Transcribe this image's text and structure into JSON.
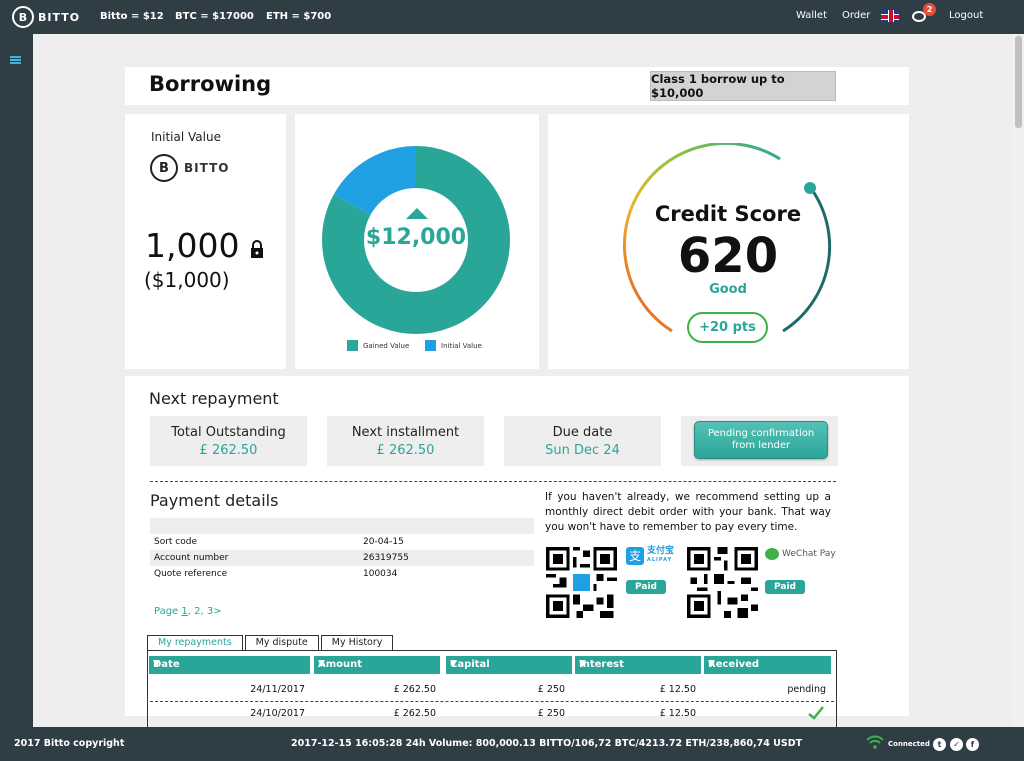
{
  "header": {
    "brand": "BITTO",
    "brand_glyph": "B",
    "tickers": [
      "Bitto = $12",
      "BTC = $17000",
      "ETH = $700"
    ],
    "nav": {
      "wallet": "Wallet",
      "order": "Order",
      "logout": "Logout"
    },
    "notification_count": "2"
  },
  "page": {
    "title": "Borrowing",
    "class_button": "Class 1 borrow up to $10,000"
  },
  "initial_value": {
    "label": "Initial Value",
    "brand": "BITTO",
    "amount": "1,000",
    "usd": "($1,000)"
  },
  "donut": {
    "value": "$12,000",
    "legend": [
      {
        "label": "Gained Value",
        "color": "#2aa698"
      },
      {
        "label": "Initial Value",
        "color": "#1fa0e2"
      }
    ],
    "gained_fraction": 0.83,
    "initial_fraction": 0.17
  },
  "credit": {
    "label": "Credit Score",
    "score": "620",
    "rating": "Good",
    "change": "+20 pts"
  },
  "repayment": {
    "title": "Next repayment",
    "stats": [
      {
        "label": "Total Outstanding",
        "value": "£ 262.50"
      },
      {
        "label": "Next installment",
        "value": "£ 262.50"
      },
      {
        "label": "Due date",
        "value": "Sun Dec 24"
      }
    ],
    "pending_button": "Pending confirmation from lender"
  },
  "payment_details": {
    "title": "Payment details",
    "rows": [
      {
        "key": "Sort code",
        "value": "20-04-15"
      },
      {
        "key": "Account number",
        "value": "26319755"
      },
      {
        "key": "Quote reference",
        "value": "100034"
      }
    ],
    "pager_prefix": "Page ",
    "pager_links": [
      "1",
      "2",
      "3>"
    ],
    "recommendation": "If you haven't already, we recommend setting up a monthly direct debit order with your bank. That way you won't have to remember to pay every time.",
    "alipay_name": "支付宝",
    "alipay_sub": "ALIPAY",
    "wechat_name": "WeChat Pay",
    "paid_label": "Paid"
  },
  "tabs": [
    "My repayments",
    "My dispute",
    "My History"
  ],
  "table": {
    "headers": [
      "Date",
      "Amount",
      "Capital",
      "Interest",
      "Received"
    ],
    "rows": [
      {
        "date": "24/11/2017",
        "amount": "£ 262.50",
        "capital": "£ 250",
        "interest": "£ 12.50",
        "received": "pending"
      },
      {
        "date": "24/10/2017",
        "amount": "£ 262.50",
        "capital": "£ 250",
        "interest": "£ 12.50",
        "received": ""
      }
    ]
  },
  "footer": {
    "copyright": "2017 Bitto copyright",
    "stats": "2017-12-15 16:05:28 24h Volume: 800,000.13 BITTO/106,72 BTC/4213.72 ETH/238,860,74 USDT",
    "status": "Connected"
  },
  "colors": {
    "accent": "#2aa698",
    "blue": "#1fa0e2",
    "dark": "#2f3d45"
  }
}
